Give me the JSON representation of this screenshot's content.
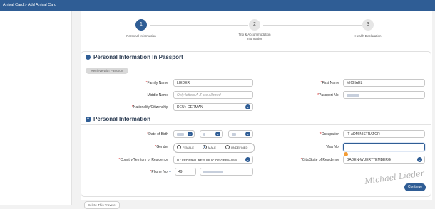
{
  "header": {
    "breadcrumb": "Arrival Card > Add Arrival Card"
  },
  "stepper": {
    "steps": [
      {
        "num": "1",
        "label": "Personal Information",
        "label2": ""
      },
      {
        "num": "2",
        "label": "Trip & Accommodation",
        "label2": "Information"
      },
      {
        "num": "3",
        "label": "Health Declaration",
        "label2": ""
      }
    ]
  },
  "passport_section": {
    "title": "Personal Information In Passport",
    "retrieve_label": "Retrieve with Passport",
    "family_name_label": "Family Name",
    "family_name_value": "LIEDER",
    "first_name_label": "First Name",
    "first_name_value": "MICHAEL",
    "middle_name_label": "Middle Name",
    "middle_name_placeholder": "Only letters A-Z are allowed",
    "passport_no_label": "Passport No.",
    "nationality_label": "Nationality/Citizenship",
    "nationality_value": "DEU : GERMAN"
  },
  "personal_section": {
    "title": "Personal Information",
    "dob_label": "Date of Birth",
    "occupation_label": "Occupation",
    "occupation_value": "IT-ADMINISTRATOR",
    "gender_label": "Gender",
    "gender_options": [
      "FEMALE",
      "MALE",
      "UNDEFINED"
    ],
    "gender_selected": "MALE",
    "visa_label": "Visa No.",
    "country_label": "Country/Territory of Residence",
    "country_value": "U : FEDERAL REPUBLIC OF GERMANY",
    "city_label": "City/State of Residence",
    "city_value": "BADEN-WUERTTEMBERG",
    "phone_label": "Phone No.",
    "phone_plus": "+",
    "phone_code": "49"
  },
  "buttons": {
    "continue": "Continue",
    "delete": "Delete This Traveler"
  },
  "colors": {
    "primary": "#2f5d95",
    "required": "#d62020",
    "badge": "#f39c35"
  }
}
